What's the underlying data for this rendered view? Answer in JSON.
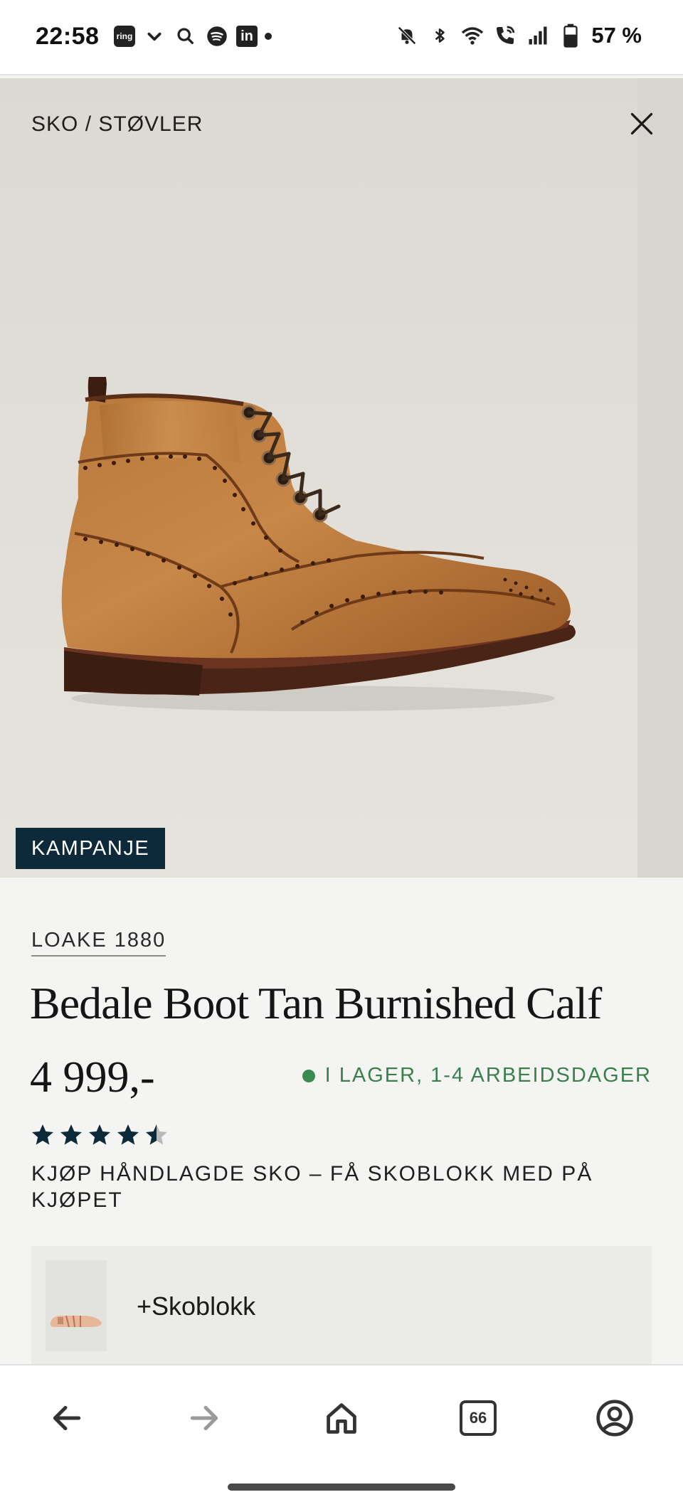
{
  "status_bar": {
    "time": "22:58",
    "left_icons": [
      "ring-icon",
      "check-down-icon",
      "search-icon",
      "spotify-icon",
      "linkedin-icon",
      "dot-icon"
    ],
    "ring_label": "ring",
    "linkedin_label": "in",
    "right_icons": [
      "mute-icon",
      "bluetooth-icon",
      "wifi-icon",
      "wifi-call-icon",
      "signal-icon",
      "battery-icon"
    ],
    "battery": "57 %"
  },
  "hero": {
    "breadcrumb": "SKO / STØVLER",
    "badge": "KAMPANJE"
  },
  "product": {
    "brand": "LOAKE 1880",
    "title": "Bedale Boot Tan Burnished Calf",
    "price": "4 999,-",
    "stock": "I LAGER, 1-4 ARBEIDSDAGER",
    "stock_color": "#3b8a4f",
    "rating": 4.5,
    "rating_max": 5,
    "promo": "KJØP HÅNDLAGDE SKO – FÅ SKOBLOKK MED PÅ KJØPET",
    "addon_label": "+Skoblokk"
  },
  "colors": {
    "badge_bg": "#0d2a3a",
    "star": "#0d2a3a"
  },
  "browser_nav": {
    "tab_count": "66",
    "icons": [
      "back-arrow-icon",
      "forward-arrow-icon",
      "home-icon",
      "tabs-icon",
      "account-icon"
    ]
  }
}
